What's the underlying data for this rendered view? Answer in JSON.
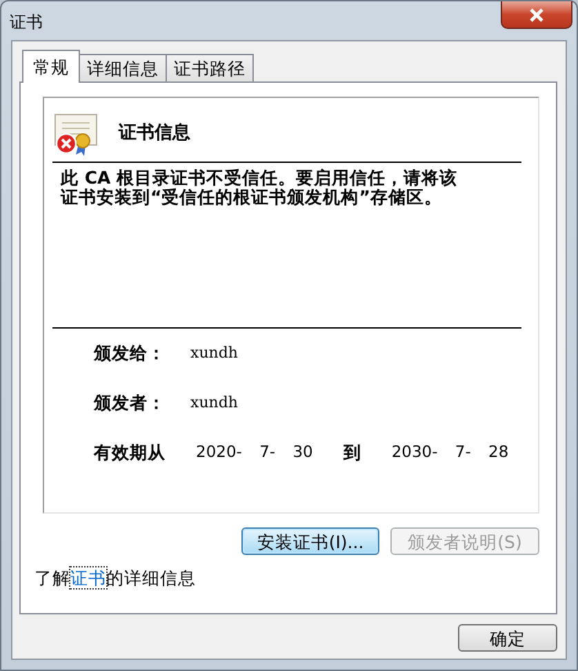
{
  "window": {
    "title": "证书"
  },
  "tabs": [
    {
      "label": "常规",
      "selected": true
    },
    {
      "label": "详细信息",
      "selected": false
    },
    {
      "label": "证书路径",
      "selected": false
    }
  ],
  "cert_info": {
    "heading": "证书信息",
    "trusted": false,
    "message": "此 CA 根目录证书不受信任。要启用信任，请将该证书安装到“受信任的根证书颁发机构”存储区。"
  },
  "fields": [
    {
      "label": "颁发给：",
      "value": "xundh"
    },
    {
      "label": "颁发者：",
      "value": "xundh"
    }
  ],
  "validity": {
    "label": "有效期从",
    "from": "2020- 7- 30",
    "to_label": "到",
    "to": "2030- 7- 28"
  },
  "buttons": [
    {
      "label": "安装证书(I)...",
      "disabled": false,
      "focused": true
    },
    {
      "label": "颁发者说明(S)",
      "disabled": true,
      "focused": false
    }
  ],
  "learn_more": {
    "before": "了解",
    "link": "证书",
    "after": "的详细信息"
  },
  "ok_button": {
    "label": "确定"
  }
}
